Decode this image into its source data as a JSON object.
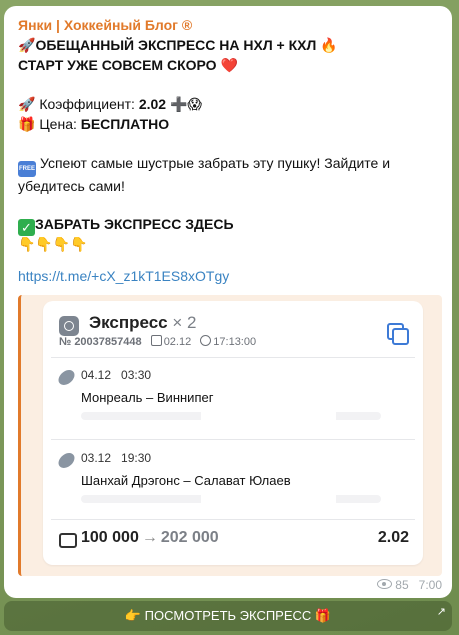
{
  "message": {
    "channel_name": "Янки | Хоккейный Блог ®",
    "line1_emoji": "🚀",
    "line1_text": "ОБЕЩАННЫЙ ЭКСПРЕСС НА НХЛ + КХЛ",
    "line1_end": "🔥",
    "line2_text": "СТАРТ УЖЕ СОВСЕМ СКОРО",
    "line2_end": "❤️",
    "coef_emoji": "🚀",
    "coef_label": "Коэффициент: ",
    "coef_value": "2.02",
    "coef_end": "➕😱",
    "price_emoji": "🎁",
    "price_label": "Цена: ",
    "price_value": "БЕСПЛАТНО",
    "free_badge": "FREE",
    "promo_text": "Успеют самые шустрые забрать эту пушку! Зайдите и",
    "promo_text2": "убедитесь сами!",
    "cta_check": "✓",
    "cta_text": "ЗАБРАТЬ ЭКСПРЕСС ЗДЕСЬ",
    "pointers": "👇👇👇👇",
    "link": "https://t.me/+cX_z1kT1ES8xOTgy"
  },
  "bet_card": {
    "title": "Экспресс",
    "multiplier": "× 2",
    "number": "№ 20037857448",
    "date": "02.12",
    "time": "17:13:00",
    "events": [
      {
        "date": "04.12",
        "time": "03:30",
        "match": "Монреаль – Виннипег"
      },
      {
        "date": "03.12",
        "time": "19:30",
        "match": "Шанхай Дрэгонс – Салават Юлаев"
      }
    ],
    "stake": "100 000",
    "arrow": "→",
    "payout": "202 000",
    "total_coef": "2.02"
  },
  "footer": {
    "views": "85",
    "time": "7:00"
  },
  "bottom_button": {
    "label": "👉 ПОСМОТРЕТЬ ЭКСПРЕСС 🎁",
    "corner": "↗"
  }
}
